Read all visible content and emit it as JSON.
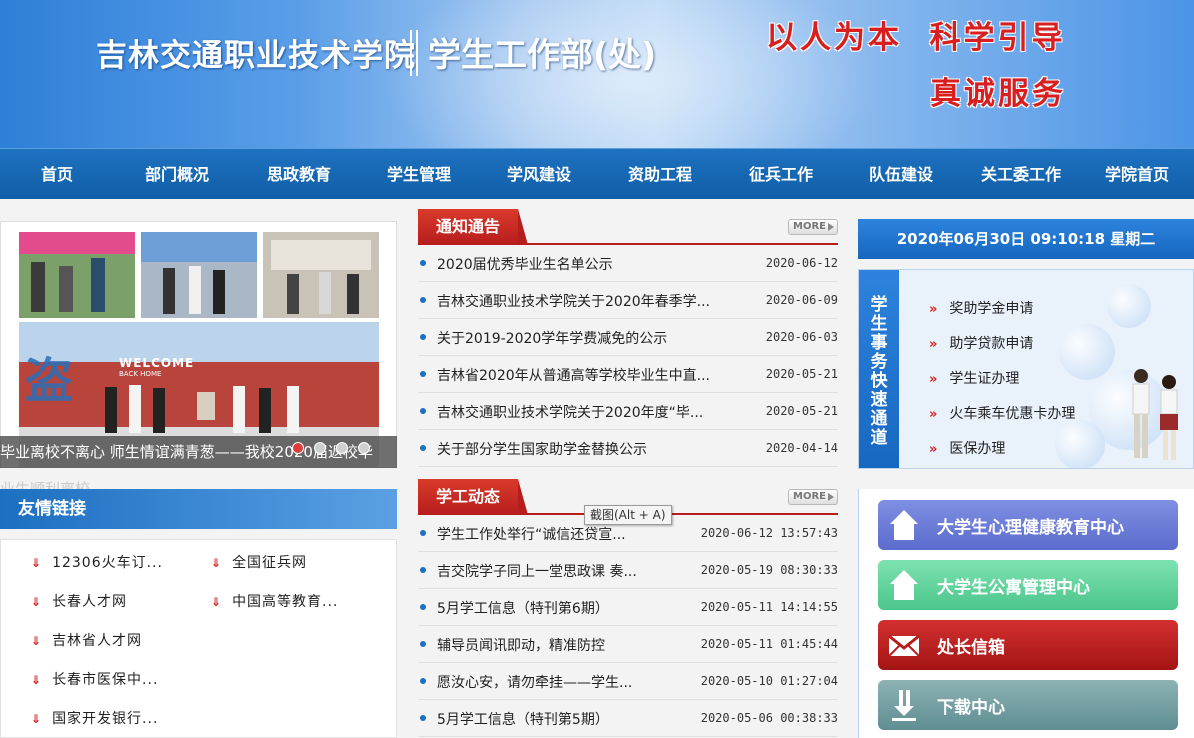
{
  "header": {
    "school_name": "吉林交通职业技术学院",
    "dept_name": "学生工作部(处)",
    "slogan_line1": "以人为本  科学引导",
    "slogan_line2": "真诚服务"
  },
  "nav": {
    "items": [
      {
        "label": "首页"
      },
      {
        "label": "部门概况"
      },
      {
        "label": "思政教育"
      },
      {
        "label": "学生管理"
      },
      {
        "label": "学风建设"
      },
      {
        "label": "资助工程"
      },
      {
        "label": "征兵工作"
      },
      {
        "label": "队伍建设"
      },
      {
        "label": "关工委工作"
      },
      {
        "label": "学院首页"
      }
    ]
  },
  "slideshow": {
    "banner_text": "WELCOME",
    "banner_sub": "BACK HOME",
    "caption": "毕业离校不离心 师生情谊满青葱——我校2020届返校毕",
    "caption_overflow": "业生顺利离校"
  },
  "friend_links": {
    "title": "友情链接",
    "items": [
      {
        "label": "12306火车订..."
      },
      {
        "label": "全国征兵网"
      },
      {
        "label": "长春人才网"
      },
      {
        "label": "中国高等教育..."
      },
      {
        "label": "吉林省人才网"
      },
      {
        "label": "长春市医保中..."
      },
      {
        "label": "国家开发银行..."
      }
    ]
  },
  "notices": {
    "title": "通知通告",
    "more": "MORE",
    "items": [
      {
        "title": "2020届优秀毕业生名单公示",
        "date": "2020-06-12"
      },
      {
        "title": "吉林交通职业技术学院关于2020年春季学...",
        "date": "2020-06-09"
      },
      {
        "title": "关于2019-2020学年学费减免的公示",
        "date": "2020-06-03"
      },
      {
        "title": "吉林省2020年从普通高等学校毕业生中直...",
        "date": "2020-05-21"
      },
      {
        "title": "吉林交通职业技术学院关于2020年度“毕...",
        "date": "2020-05-21"
      },
      {
        "title": "关于部分学生国家助学金替换公示",
        "date": "2020-04-14"
      }
    ]
  },
  "news": {
    "title": "学工动态",
    "more": "MORE",
    "items": [
      {
        "title": "学生工作处举行“诚信还贷宣...",
        "date": "2020-06-12 13:57:43"
      },
      {
        "title": "吉交院学子同上一堂思政课 奏...",
        "date": "2020-05-19 08:30:33"
      },
      {
        "title": "5月学工信息（特刊第6期）",
        "date": "2020-05-11 14:14:55"
      },
      {
        "title": "辅导员闻讯即动，精准防控",
        "date": "2020-05-11 01:45:44"
      },
      {
        "title": "愿汝心安，请勿牵挂——学生...",
        "date": "2020-05-10 01:27:04"
      },
      {
        "title": "5月学工信息（特刊第5期）",
        "date": "2020-05-06 00:38:33"
      }
    ]
  },
  "tooltip": {
    "text": "截图(Alt + A)"
  },
  "datetime": {
    "text": "2020年06月30日 09:10:18 星期二"
  },
  "fast_channel": {
    "side_title": [
      "学",
      "生",
      "事",
      "务",
      "快",
      "速",
      "通",
      "道"
    ],
    "items": [
      {
        "label": "奖助学金申请"
      },
      {
        "label": "助学贷款申请"
      },
      {
        "label": "学生证办理"
      },
      {
        "label": "火车乘车优惠卡办理"
      },
      {
        "label": "医保办理"
      }
    ]
  },
  "services": [
    {
      "label": "大学生心理健康教育中心",
      "icon": "home-icon"
    },
    {
      "label": "大学生公寓管理中心",
      "icon": "home-icon"
    },
    {
      "label": "处长信箱",
      "icon": "mail-icon"
    },
    {
      "label": "下载中心",
      "icon": "download-icon"
    }
  ],
  "colors": {
    "nav_blue": "#1667c0",
    "accent_red": "#b71d1d",
    "slogan_red": "#d81e1e"
  }
}
